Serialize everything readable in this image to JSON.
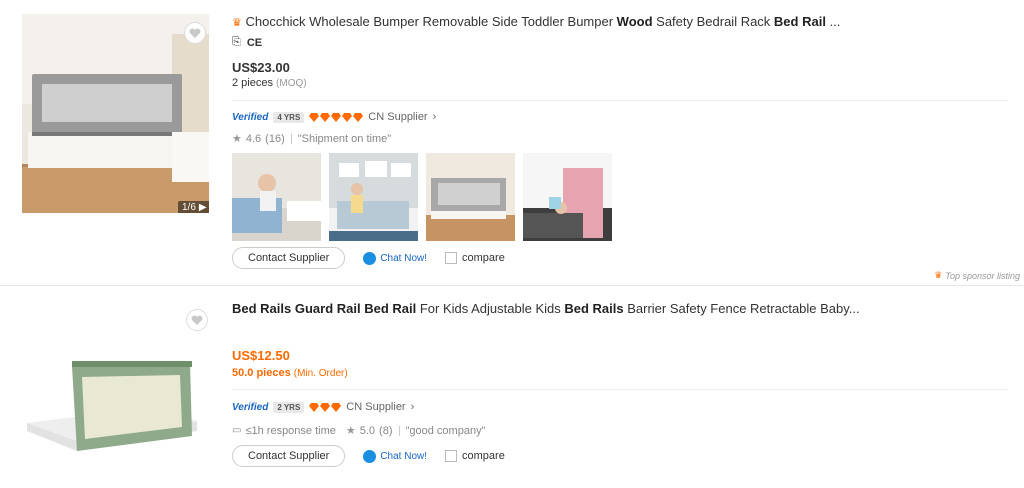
{
  "listings": [
    {
      "title_parts": [
        {
          "t": "Chocchick Wholesale Bumper Removable Side Toddler Bumper ",
          "b": false
        },
        {
          "t": "Wood",
          "b": true
        },
        {
          "t": " Safety Bedrail Rack ",
          "b": false
        },
        {
          "t": "Bed Rail",
          "b": true
        },
        {
          "t": " ...",
          "b": false
        }
      ],
      "cert": "CE",
      "price": "US$23.00",
      "moq_value": "2 pieces",
      "moq_label": "(MOQ)",
      "verified": "Verified",
      "years": "4 YRS",
      "diamonds": 5,
      "supplier": "CN Supplier",
      "rating": "4.6",
      "reviews": "(16)",
      "tag": "\"Shipment on time\"",
      "image_counter": "1/6",
      "contact": "Contact Supplier",
      "chat": "Chat Now!",
      "compare": "compare",
      "sponsor": "Top sponsor listing"
    },
    {
      "title_parts": [
        {
          "t": "Bed Rails Guard Rail Bed Rail",
          "b": true
        },
        {
          "t": " For Kids Adjustable Kids ",
          "b": false
        },
        {
          "t": "Bed Rails",
          "b": true
        },
        {
          "t": " Barrier Safety Fence Retractable Baby...",
          "b": false
        }
      ],
      "price": "US$12.50",
      "moq_value": "50.0 pieces",
      "moq_label": "(Min. Order)",
      "verified": "Verified",
      "years": "2 YRS",
      "diamonds": 3,
      "supplier": "CN Supplier",
      "response": "≤1h response time",
      "rating": "5.0",
      "reviews": "(8)",
      "tag": "\"good company\"",
      "contact": "Contact Supplier",
      "chat": "Chat Now!",
      "compare": "compare"
    }
  ],
  "colors": {
    "accent": "#ff6a00",
    "link": "#1a66c2",
    "diamond": "#ff6a00"
  }
}
